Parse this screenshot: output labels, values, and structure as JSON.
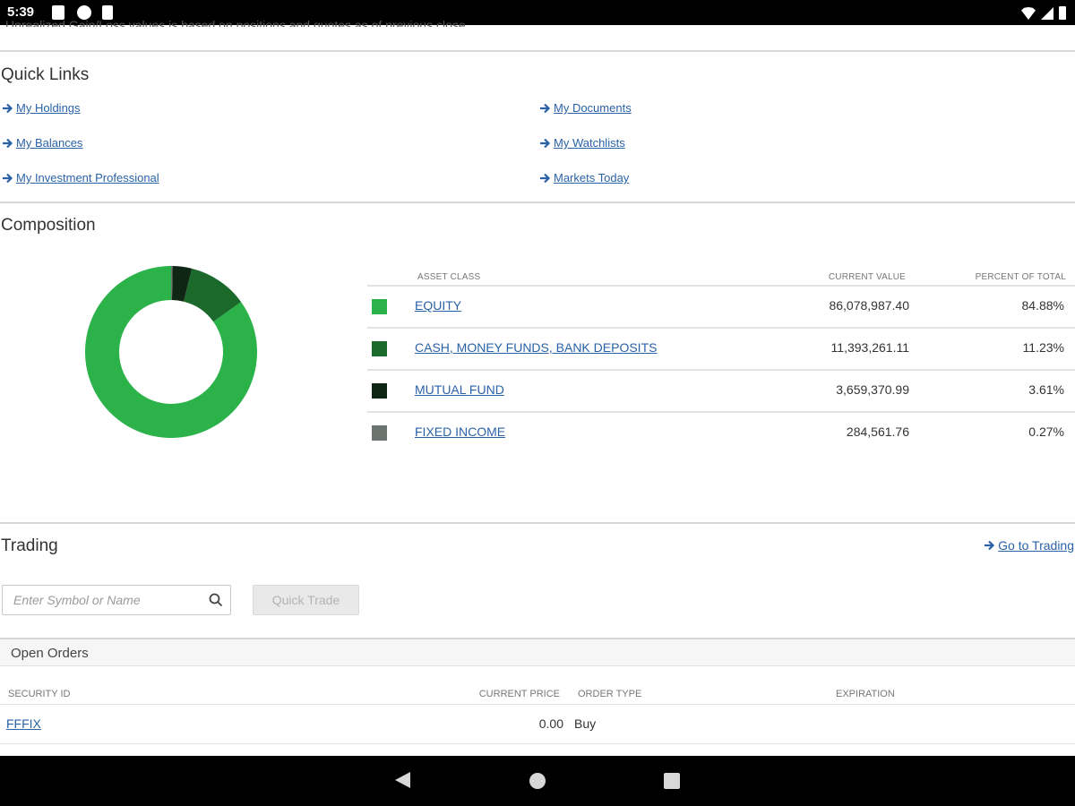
{
  "status_bar": {
    "time": "5:39"
  },
  "page_note": "Unrealized Gain/Loss values is based on positions and quotes as of previous close.",
  "quick_links": {
    "title": "Quick Links",
    "left": [
      "My Holdings",
      "My Balances",
      "My Investment Professional"
    ],
    "right": [
      "My Documents",
      "My Watchlists",
      "Markets Today"
    ]
  },
  "composition": {
    "title": "Composition",
    "headers": {
      "asset_class": "ASSET CLASS",
      "current_value": "CURRENT VALUE",
      "percent": "PERCENT OF TOTAL"
    },
    "rows": [
      {
        "label": "EQUITY",
        "value": "86,078,987.40",
        "percent": "84.88%",
        "color": "#2bb34a"
      },
      {
        "label": "CASH, MONEY FUNDS, BANK DEPOSITS",
        "value": "11,393,261.11",
        "percent": "11.23%",
        "color": "#1b6a2c"
      },
      {
        "label": "MUTUAL FUND",
        "value": "3,659,370.99",
        "percent": "3.61%",
        "color": "#0f2614"
      },
      {
        "label": "FIXED INCOME",
        "value": "284,561.76",
        "percent": "0.27%",
        "color": "#6c7470"
      }
    ]
  },
  "chart_data": {
    "type": "pie",
    "categories": [
      "EQUITY",
      "CASH, MONEY FUNDS, BANK DEPOSITS",
      "MUTUAL FUND",
      "FIXED INCOME"
    ],
    "values": [
      84.88,
      11.23,
      3.61,
      0.27
    ],
    "colors": [
      "#2bb34a",
      "#1b6a2c",
      "#0f2614",
      "#6c7470"
    ],
    "donut": true
  },
  "trading": {
    "title": "Trading",
    "go_to_link": "Go to Trading",
    "search_placeholder": "Enter Symbol or Name",
    "quick_trade_label": "Quick Trade",
    "open_orders": {
      "title": "Open Orders",
      "headers": {
        "security_id": "SECURITY ID",
        "current_price": "CURRENT PRICE",
        "order_type": "ORDER TYPE",
        "expiration": "EXPIRATION"
      },
      "rows": [
        {
          "security_id": "FFFIX",
          "current_price": "0.00",
          "order_type": "Buy",
          "expiration": ""
        }
      ]
    }
  }
}
